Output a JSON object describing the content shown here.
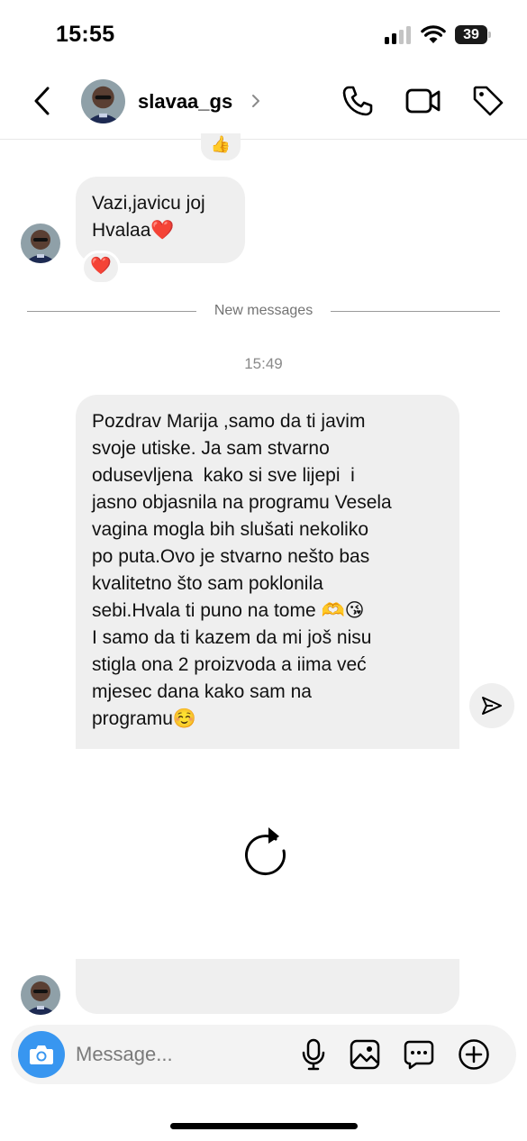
{
  "status_bar": {
    "time": "15:55",
    "battery": "39"
  },
  "header": {
    "username": "slavaa_gs",
    "icons": [
      "back-icon",
      "chevron-right-icon",
      "phone-icon",
      "video-camera-icon",
      "tag-icon"
    ]
  },
  "messages": {
    "reaction_top": "👍",
    "incoming_1": {
      "lines": [
        "Vazi,javicu joj",
        "Hvalaa❤️"
      ],
      "reaction": "❤️"
    },
    "new_messages_label": "New messages",
    "timestamp": "15:49",
    "incoming_2": {
      "lines": [
        "Pozdrav Marija ,samo da ti javim",
        "svoje utiske. Ja sam stvarno",
        "odusevljena  kako si sve lijepi  i",
        "jasno objasnila na programu Vesela",
        "vagina mogla bih slušati nekoliko",
        "po puta.Ovo je stvarno nešto bas",
        "kvalitetno što sam poklonila",
        "sebi.Hvala ti puno na tome 🫶😘",
        "I samo da ti kazem da mi još nisu",
        "stigla ona 2 proizvoda a iima već",
        "mjesec dana kako sam na",
        "programu☺️"
      ]
    }
  },
  "composer": {
    "placeholder": "Message...",
    "icons": [
      "camera-icon",
      "microphone-icon",
      "gallery-icon",
      "sticker-icon",
      "plus-icon"
    ]
  },
  "colors": {
    "accent": "#3896f0",
    "bubble": "#efefef",
    "heart": "#e0102e"
  }
}
